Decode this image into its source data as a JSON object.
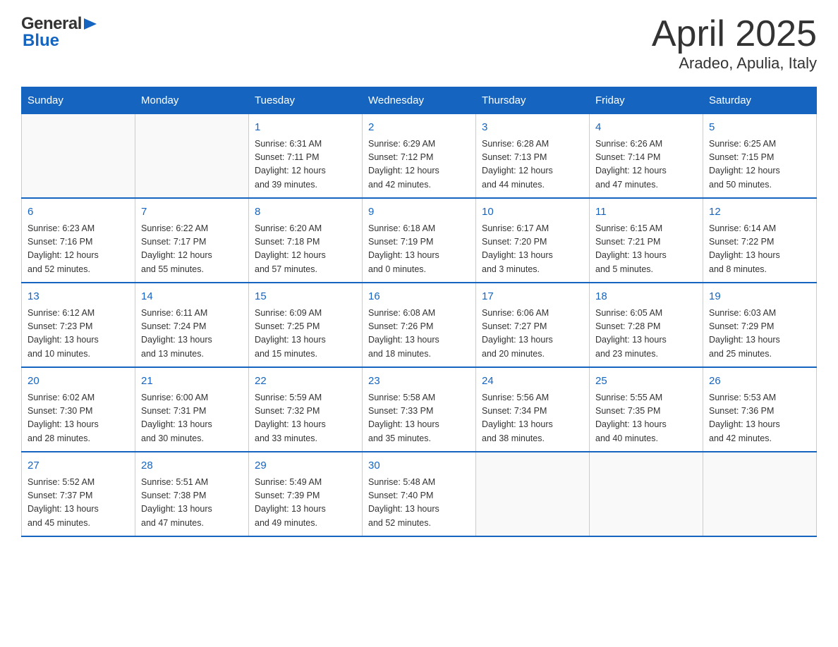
{
  "logo": {
    "general": "General",
    "blue": "Blue"
  },
  "title": "April 2025",
  "subtitle": "Aradeo, Apulia, Italy",
  "days_of_week": [
    "Sunday",
    "Monday",
    "Tuesday",
    "Wednesday",
    "Thursday",
    "Friday",
    "Saturday"
  ],
  "weeks": [
    {
      "days": [
        {
          "number": "",
          "info": ""
        },
        {
          "number": "",
          "info": ""
        },
        {
          "number": "1",
          "info": "Sunrise: 6:31 AM\nSunset: 7:11 PM\nDaylight: 12 hours\nand 39 minutes."
        },
        {
          "number": "2",
          "info": "Sunrise: 6:29 AM\nSunset: 7:12 PM\nDaylight: 12 hours\nand 42 minutes."
        },
        {
          "number": "3",
          "info": "Sunrise: 6:28 AM\nSunset: 7:13 PM\nDaylight: 12 hours\nand 44 minutes."
        },
        {
          "number": "4",
          "info": "Sunrise: 6:26 AM\nSunset: 7:14 PM\nDaylight: 12 hours\nand 47 minutes."
        },
        {
          "number": "5",
          "info": "Sunrise: 6:25 AM\nSunset: 7:15 PM\nDaylight: 12 hours\nand 50 minutes."
        }
      ]
    },
    {
      "days": [
        {
          "number": "6",
          "info": "Sunrise: 6:23 AM\nSunset: 7:16 PM\nDaylight: 12 hours\nand 52 minutes."
        },
        {
          "number": "7",
          "info": "Sunrise: 6:22 AM\nSunset: 7:17 PM\nDaylight: 12 hours\nand 55 minutes."
        },
        {
          "number": "8",
          "info": "Sunrise: 6:20 AM\nSunset: 7:18 PM\nDaylight: 12 hours\nand 57 minutes."
        },
        {
          "number": "9",
          "info": "Sunrise: 6:18 AM\nSunset: 7:19 PM\nDaylight: 13 hours\nand 0 minutes."
        },
        {
          "number": "10",
          "info": "Sunrise: 6:17 AM\nSunset: 7:20 PM\nDaylight: 13 hours\nand 3 minutes."
        },
        {
          "number": "11",
          "info": "Sunrise: 6:15 AM\nSunset: 7:21 PM\nDaylight: 13 hours\nand 5 minutes."
        },
        {
          "number": "12",
          "info": "Sunrise: 6:14 AM\nSunset: 7:22 PM\nDaylight: 13 hours\nand 8 minutes."
        }
      ]
    },
    {
      "days": [
        {
          "number": "13",
          "info": "Sunrise: 6:12 AM\nSunset: 7:23 PM\nDaylight: 13 hours\nand 10 minutes."
        },
        {
          "number": "14",
          "info": "Sunrise: 6:11 AM\nSunset: 7:24 PM\nDaylight: 13 hours\nand 13 minutes."
        },
        {
          "number": "15",
          "info": "Sunrise: 6:09 AM\nSunset: 7:25 PM\nDaylight: 13 hours\nand 15 minutes."
        },
        {
          "number": "16",
          "info": "Sunrise: 6:08 AM\nSunset: 7:26 PM\nDaylight: 13 hours\nand 18 minutes."
        },
        {
          "number": "17",
          "info": "Sunrise: 6:06 AM\nSunset: 7:27 PM\nDaylight: 13 hours\nand 20 minutes."
        },
        {
          "number": "18",
          "info": "Sunrise: 6:05 AM\nSunset: 7:28 PM\nDaylight: 13 hours\nand 23 minutes."
        },
        {
          "number": "19",
          "info": "Sunrise: 6:03 AM\nSunset: 7:29 PM\nDaylight: 13 hours\nand 25 minutes."
        }
      ]
    },
    {
      "days": [
        {
          "number": "20",
          "info": "Sunrise: 6:02 AM\nSunset: 7:30 PM\nDaylight: 13 hours\nand 28 minutes."
        },
        {
          "number": "21",
          "info": "Sunrise: 6:00 AM\nSunset: 7:31 PM\nDaylight: 13 hours\nand 30 minutes."
        },
        {
          "number": "22",
          "info": "Sunrise: 5:59 AM\nSunset: 7:32 PM\nDaylight: 13 hours\nand 33 minutes."
        },
        {
          "number": "23",
          "info": "Sunrise: 5:58 AM\nSunset: 7:33 PM\nDaylight: 13 hours\nand 35 minutes."
        },
        {
          "number": "24",
          "info": "Sunrise: 5:56 AM\nSunset: 7:34 PM\nDaylight: 13 hours\nand 38 minutes."
        },
        {
          "number": "25",
          "info": "Sunrise: 5:55 AM\nSunset: 7:35 PM\nDaylight: 13 hours\nand 40 minutes."
        },
        {
          "number": "26",
          "info": "Sunrise: 5:53 AM\nSunset: 7:36 PM\nDaylight: 13 hours\nand 42 minutes."
        }
      ]
    },
    {
      "days": [
        {
          "number": "27",
          "info": "Sunrise: 5:52 AM\nSunset: 7:37 PM\nDaylight: 13 hours\nand 45 minutes."
        },
        {
          "number": "28",
          "info": "Sunrise: 5:51 AM\nSunset: 7:38 PM\nDaylight: 13 hours\nand 47 minutes."
        },
        {
          "number": "29",
          "info": "Sunrise: 5:49 AM\nSunset: 7:39 PM\nDaylight: 13 hours\nand 49 minutes."
        },
        {
          "number": "30",
          "info": "Sunrise: 5:48 AM\nSunset: 7:40 PM\nDaylight: 13 hours\nand 52 minutes."
        },
        {
          "number": "",
          "info": ""
        },
        {
          "number": "",
          "info": ""
        },
        {
          "number": "",
          "info": ""
        }
      ]
    }
  ]
}
